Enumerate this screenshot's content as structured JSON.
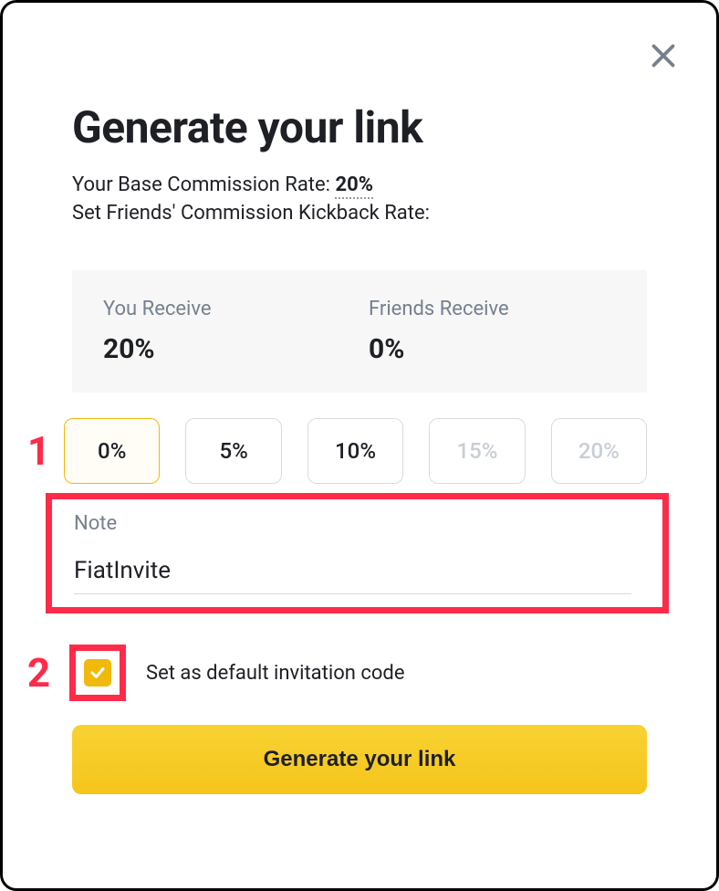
{
  "dialog": {
    "title": "Generate your link",
    "close_icon": "close-icon"
  },
  "base": {
    "label": "Your Base Commission Rate:",
    "rate": "20%"
  },
  "kickback": {
    "label": "Set Friends' Commission Kickback Rate:"
  },
  "receive": {
    "you_label": "You Receive",
    "you_value": "20%",
    "friends_label": "Friends Receive",
    "friends_value": "0%"
  },
  "options": [
    {
      "label": "0%",
      "selected": true,
      "disabled": false
    },
    {
      "label": "5%",
      "selected": false,
      "disabled": false
    },
    {
      "label": "10%",
      "selected": false,
      "disabled": false
    },
    {
      "label": "15%",
      "selected": false,
      "disabled": true
    },
    {
      "label": "20%",
      "selected": false,
      "disabled": true
    }
  ],
  "note": {
    "label": "Note",
    "value": "FiatInvite"
  },
  "default_checkbox": {
    "checked": true,
    "label": "Set as default invitation code"
  },
  "generate_button": {
    "label": "Generate your link"
  },
  "annotations": {
    "marker_1": "1",
    "marker_2": "2"
  },
  "colors": {
    "accent": "#f0b90b",
    "highlight": "#ff2b49",
    "panel_bg": "#f7f7f7",
    "text_muted": "#76808f"
  }
}
